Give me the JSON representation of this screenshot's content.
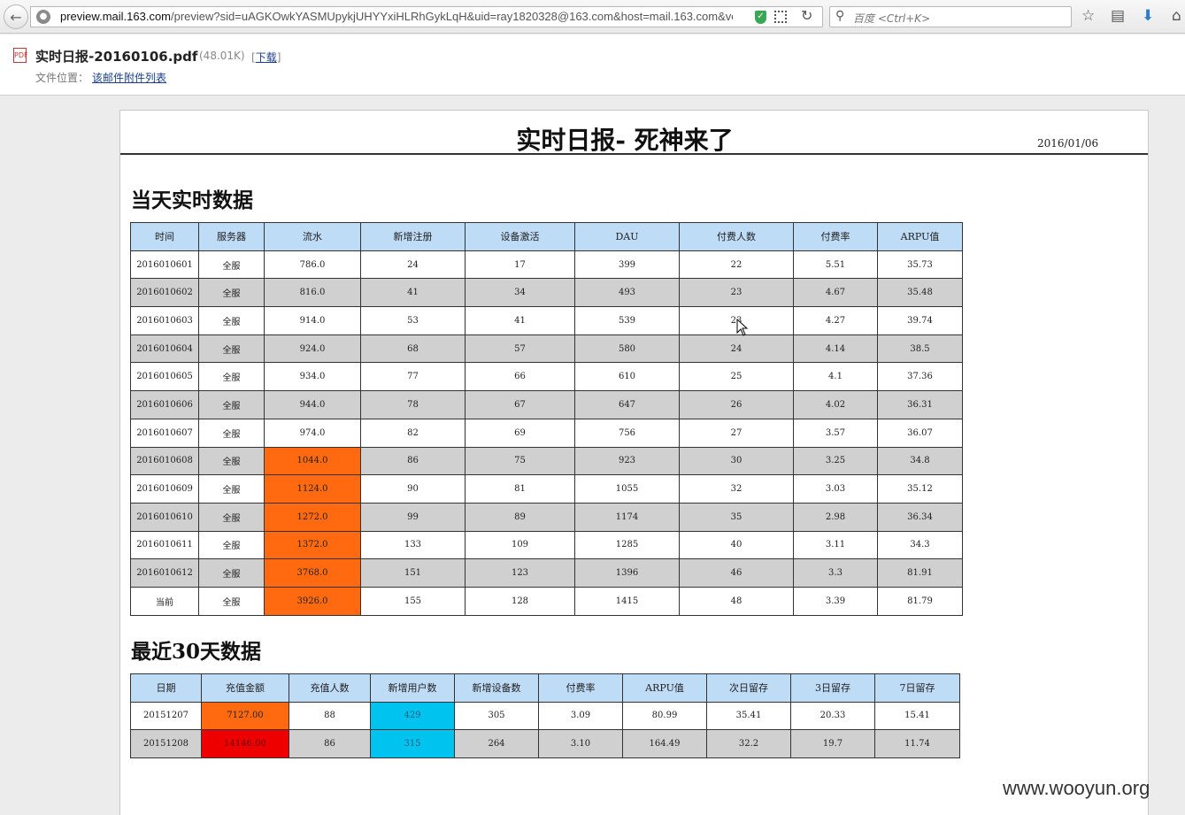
{
  "browser": {
    "url_host": "preview.mail.163.com",
    "url_rest": "/preview?sid=uAGKOwkYASMUpykjUHYYxiHLRhGykLqH&uid=ray1820328@163.com&host=mail.163.com&ver",
    "search_placeholder": "百度 <Ctrl+K>"
  },
  "attachment": {
    "file_name": "实时日报-20160106.pdf",
    "file_size": "(48.01K)",
    "download_open": "[",
    "download_label": "下载",
    "download_close": "]",
    "location_label": "文件位置：",
    "location_link": "该邮件附件列表"
  },
  "report": {
    "title": "实时日报- 死神来了",
    "date": "2016/01/06",
    "section1_title": "当天实时数据",
    "section2_title": "最近30天数据"
  },
  "table_today": {
    "headers": [
      "时间",
      "服务器",
      "流水",
      "新增注册",
      "设备激活",
      "DAU",
      "付费人数",
      "付费率",
      "ARPU值"
    ],
    "rows": [
      [
        "2016010601",
        "全服",
        "786.0",
        "24",
        "17",
        "399",
        "22",
        "5.51",
        "35.73"
      ],
      [
        "2016010602",
        "全服",
        "816.0",
        "41",
        "34",
        "493",
        "23",
        "4.67",
        "35.48"
      ],
      [
        "2016010603",
        "全服",
        "914.0",
        "53",
        "41",
        "539",
        "23",
        "4.27",
        "39.74"
      ],
      [
        "2016010604",
        "全服",
        "924.0",
        "68",
        "57",
        "580",
        "24",
        "4.14",
        "38.5"
      ],
      [
        "2016010605",
        "全服",
        "934.0",
        "77",
        "66",
        "610",
        "25",
        "4.1",
        "37.36"
      ],
      [
        "2016010606",
        "全服",
        "944.0",
        "78",
        "67",
        "647",
        "26",
        "4.02",
        "36.31"
      ],
      [
        "2016010607",
        "全服",
        "974.0",
        "82",
        "69",
        "756",
        "27",
        "3.57",
        "36.07"
      ],
      [
        "2016010608",
        "全服",
        "1044.0",
        "86",
        "75",
        "923",
        "30",
        "3.25",
        "34.8"
      ],
      [
        "2016010609",
        "全服",
        "1124.0",
        "90",
        "81",
        "1055",
        "32",
        "3.03",
        "35.12"
      ],
      [
        "2016010610",
        "全服",
        "1272.0",
        "99",
        "89",
        "1174",
        "35",
        "2.98",
        "36.34"
      ],
      [
        "2016010611",
        "全服",
        "1372.0",
        "133",
        "109",
        "1285",
        "40",
        "3.11",
        "34.3"
      ],
      [
        "2016010612",
        "全服",
        "3768.0",
        "151",
        "123",
        "1396",
        "46",
        "3.3",
        "81.91"
      ],
      [
        "当前",
        "全服",
        "3926.0",
        "155",
        "128",
        "1415",
        "48",
        "3.39",
        "81.79"
      ]
    ],
    "orange_from_row": 7,
    "highlight_color": "#ff6a10"
  },
  "table_30d": {
    "headers": [
      "日期",
      "充值金额",
      "充值人数",
      "新增用户数",
      "新增设备数",
      "付费率",
      "ARPU值",
      "次日留存",
      "3日留存",
      "7日留存"
    ],
    "rows": [
      [
        "20151207",
        "7127.00",
        "88",
        "429",
        "305",
        "3.09",
        "80.99",
        "35.41",
        "20.33",
        "15.41"
      ],
      [
        "20151208",
        "14146.00",
        "86",
        "315",
        "264",
        "3.10",
        "164.49",
        "32.2",
        "19.7",
        "11.74"
      ]
    ],
    "colors": {
      "orange": "#ff6a10",
      "red": "#ee0000",
      "cyan": "#00c4ef",
      "header_blue": "#bfdcf7"
    }
  },
  "watermark": "www.wooyun.org"
}
